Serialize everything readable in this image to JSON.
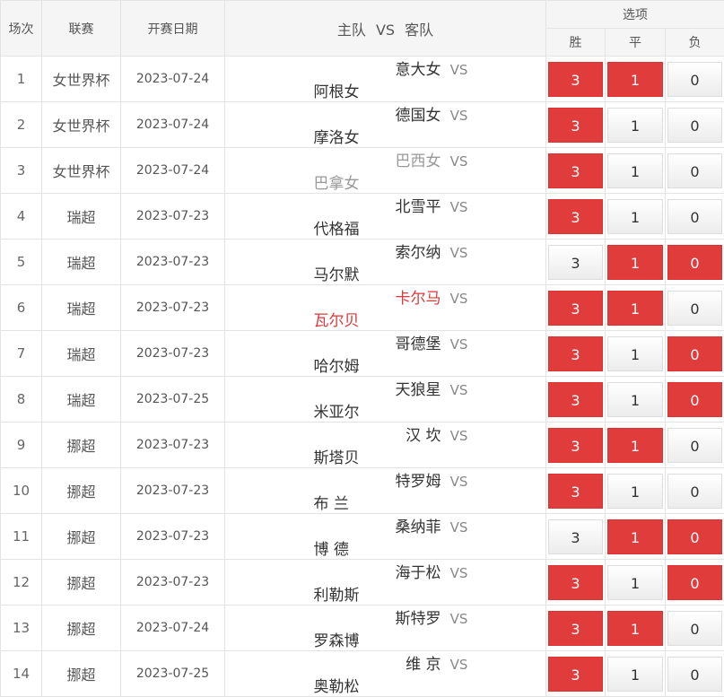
{
  "headers": {
    "num": "场次",
    "league": "联赛",
    "date": "开赛日期",
    "home": "主队",
    "vs": "VS",
    "away": "客队",
    "options": "选项",
    "win": "胜",
    "draw": "平",
    "lose": "负"
  },
  "colors": {
    "selected": "#e03c3c",
    "muted_team": "#999999",
    "highlight_team": "#d93a3a"
  },
  "rows": [
    {
      "num": "1",
      "league": "女世界杯",
      "date": "2023-07-24",
      "home": "意大女",
      "vs": "VS",
      "away": "阿根女",
      "style": "normal",
      "win": "3",
      "draw": "1",
      "lose": "0",
      "sel": [
        true,
        true,
        false
      ]
    },
    {
      "num": "2",
      "league": "女世界杯",
      "date": "2023-07-24",
      "home": "德国女",
      "vs": "VS",
      "away": "摩洛女",
      "style": "normal",
      "win": "3",
      "draw": "1",
      "lose": "0",
      "sel": [
        true,
        false,
        false
      ]
    },
    {
      "num": "3",
      "league": "女世界杯",
      "date": "2023-07-24",
      "home": "巴西女",
      "vs": "VS",
      "away": "巴拿女",
      "style": "gray",
      "win": "3",
      "draw": "1",
      "lose": "0",
      "sel": [
        true,
        false,
        false
      ]
    },
    {
      "num": "4",
      "league": "瑞超",
      "date": "2023-07-23",
      "home": "北雪平",
      "vs": "VS",
      "away": "代格福",
      "style": "normal",
      "win": "3",
      "draw": "1",
      "lose": "0",
      "sel": [
        true,
        false,
        false
      ]
    },
    {
      "num": "5",
      "league": "瑞超",
      "date": "2023-07-23",
      "home": "索尔纳",
      "vs": "VS",
      "away": "马尔默",
      "style": "normal",
      "win": "3",
      "draw": "1",
      "lose": "0",
      "sel": [
        false,
        true,
        true
      ]
    },
    {
      "num": "6",
      "league": "瑞超",
      "date": "2023-07-23",
      "home": "卡尔马",
      "vs": "VS",
      "away": "瓦尔贝",
      "style": "red",
      "win": "3",
      "draw": "1",
      "lose": "0",
      "sel": [
        true,
        true,
        false
      ]
    },
    {
      "num": "7",
      "league": "瑞超",
      "date": "2023-07-23",
      "home": "哥德堡",
      "vs": "VS",
      "away": "哈尔姆",
      "style": "normal",
      "win": "3",
      "draw": "1",
      "lose": "0",
      "sel": [
        true,
        false,
        true
      ]
    },
    {
      "num": "8",
      "league": "瑞超",
      "date": "2023-07-25",
      "home": "天狼星",
      "vs": "VS",
      "away": "米亚尔",
      "style": "normal",
      "win": "3",
      "draw": "1",
      "lose": "0",
      "sel": [
        true,
        false,
        true
      ]
    },
    {
      "num": "9",
      "league": "挪超",
      "date": "2023-07-23",
      "home": "汉 坎",
      "vs": "VS",
      "away": "斯塔贝",
      "style": "normal",
      "win": "3",
      "draw": "1",
      "lose": "0",
      "sel": [
        true,
        true,
        false
      ]
    },
    {
      "num": "10",
      "league": "挪超",
      "date": "2023-07-23",
      "home": "特罗姆",
      "vs": "VS",
      "away": "布 兰",
      "style": "normal",
      "win": "3",
      "draw": "1",
      "lose": "0",
      "sel": [
        true,
        false,
        false
      ]
    },
    {
      "num": "11",
      "league": "挪超",
      "date": "2023-07-23",
      "home": "桑纳菲",
      "vs": "VS",
      "away": "博 德",
      "style": "normal",
      "win": "3",
      "draw": "1",
      "lose": "0",
      "sel": [
        false,
        true,
        true
      ]
    },
    {
      "num": "12",
      "league": "挪超",
      "date": "2023-07-23",
      "home": "海于松",
      "vs": "VS",
      "away": "利勒斯",
      "style": "normal",
      "win": "3",
      "draw": "1",
      "lose": "0",
      "sel": [
        true,
        false,
        true
      ]
    },
    {
      "num": "13",
      "league": "挪超",
      "date": "2023-07-24",
      "home": "斯特罗",
      "vs": "VS",
      "away": "罗森博",
      "style": "normal",
      "win": "3",
      "draw": "1",
      "lose": "0",
      "sel": [
        true,
        true,
        false
      ]
    },
    {
      "num": "14",
      "league": "挪超",
      "date": "2023-07-25",
      "home": "维 京",
      "vs": "VS",
      "away": "奥勒松",
      "style": "normal",
      "win": "3",
      "draw": "1",
      "lose": "0",
      "sel": [
        true,
        false,
        false
      ]
    }
  ]
}
